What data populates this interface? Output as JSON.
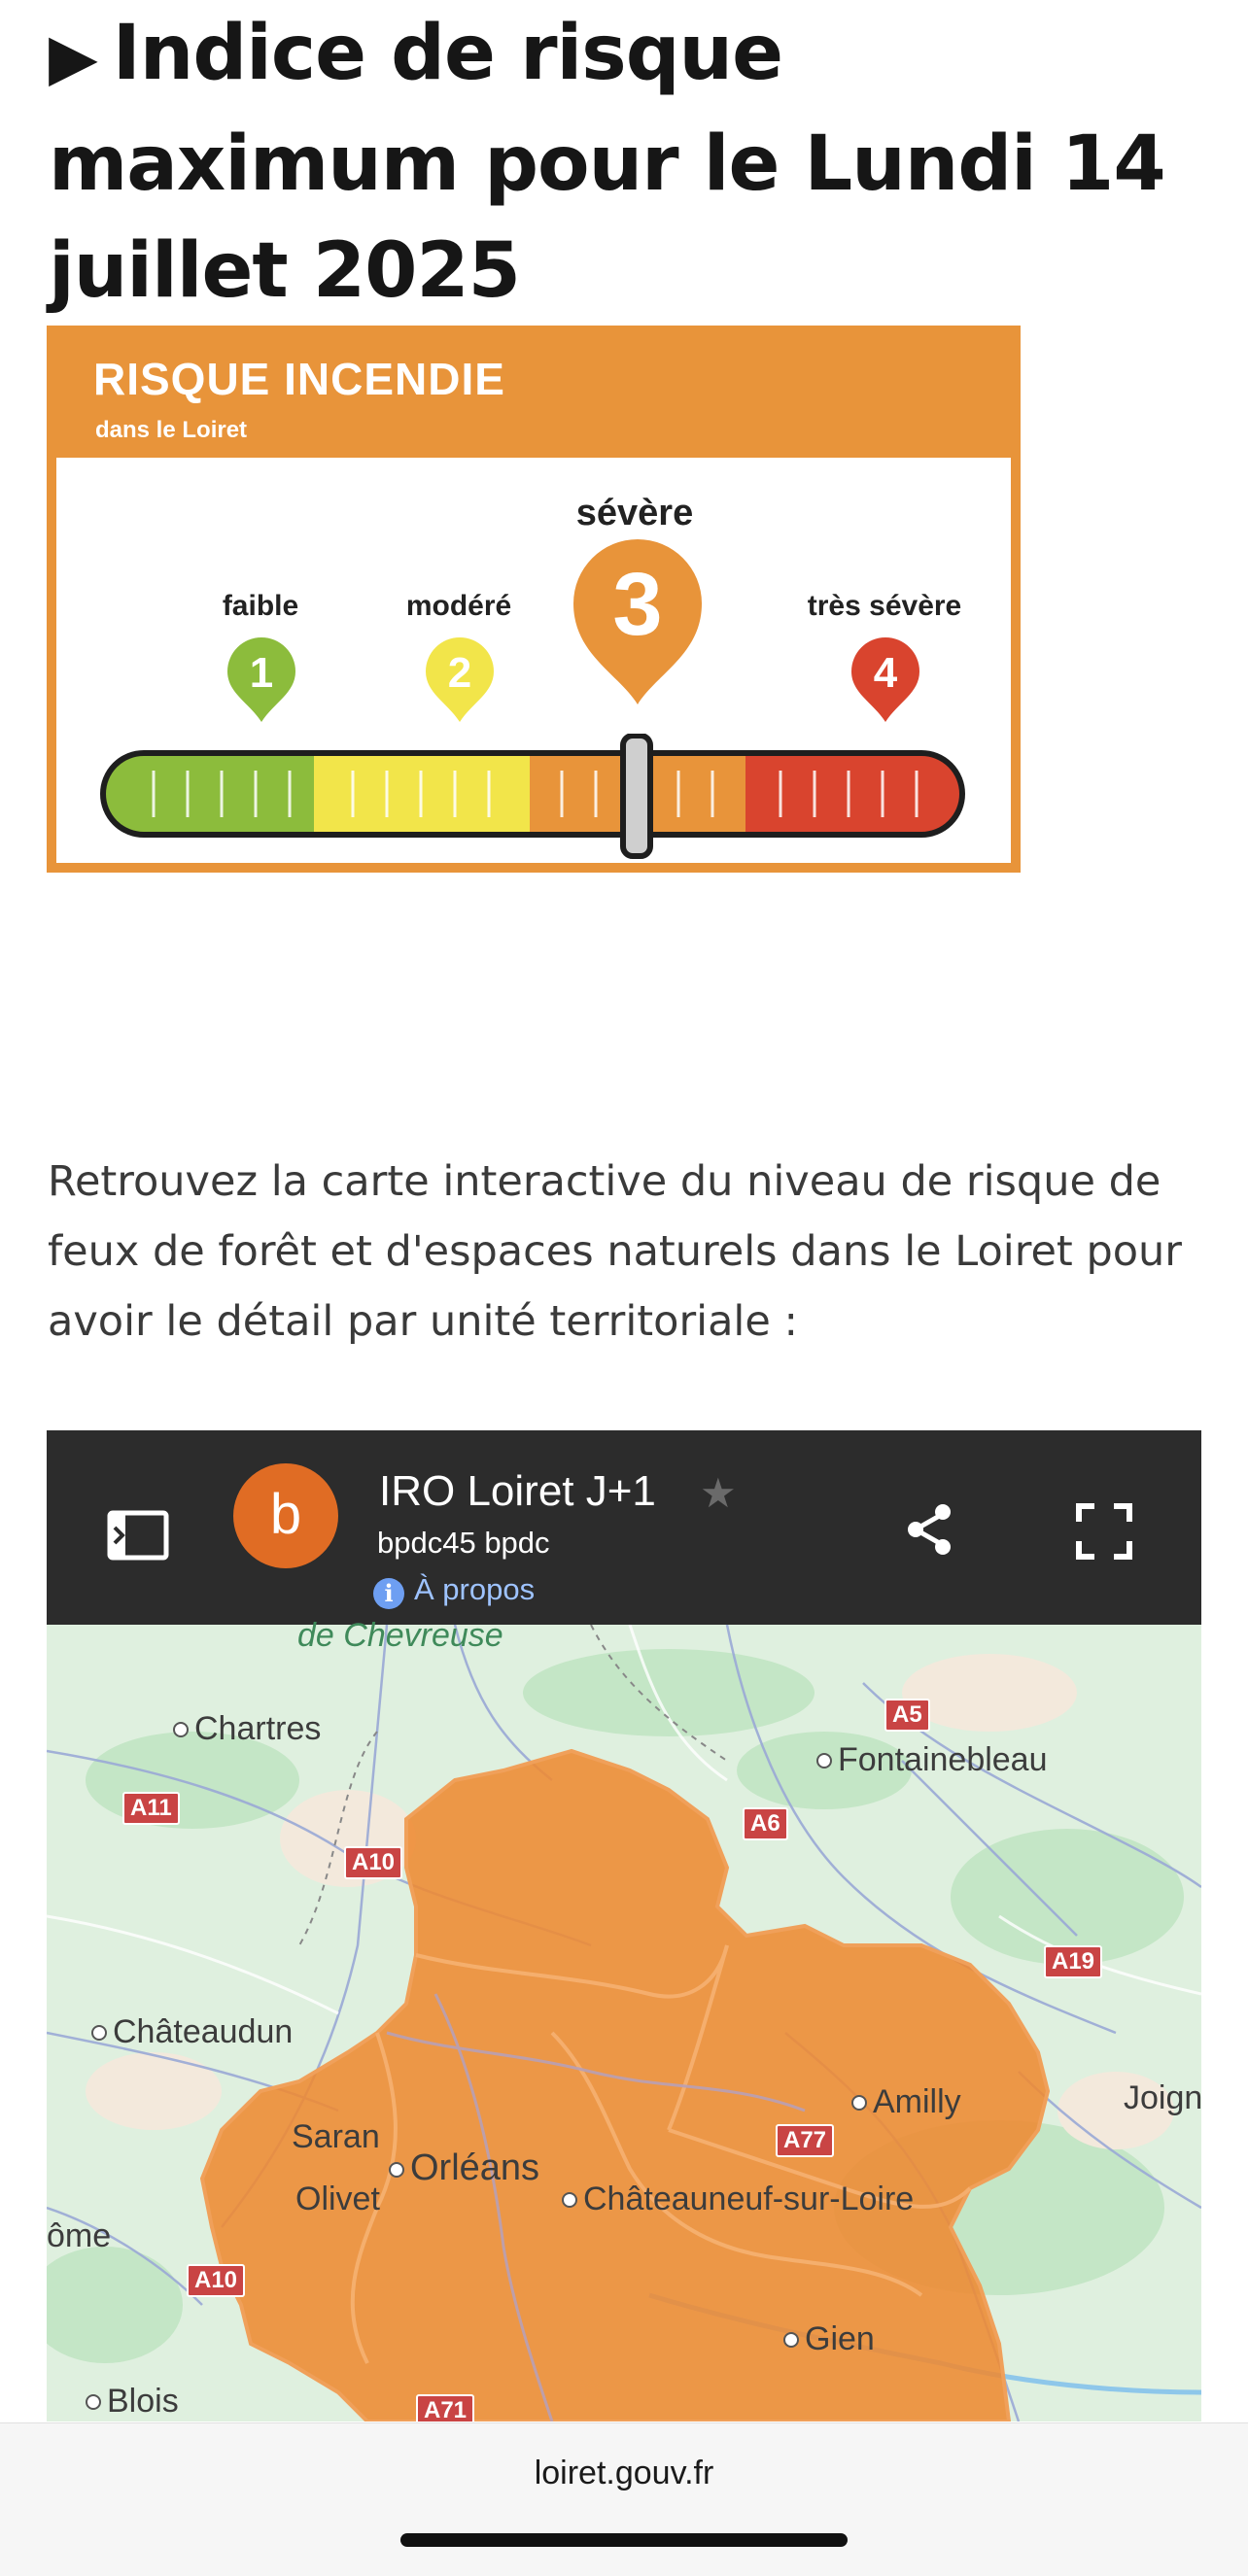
{
  "heading": {
    "icon": "play-triangle-icon",
    "text": "Indice de risque maximum pour le Lundi 14 juillet 2025"
  },
  "risk_card": {
    "title": "RISQUE INCENDIE",
    "subtitle": "dans le Loiret",
    "current_level": 3,
    "levels": [
      {
        "label": "faible",
        "number": "1",
        "color": "#8cbc3c"
      },
      {
        "label": "modéré",
        "number": "2",
        "color": "#f2e54a"
      },
      {
        "label": "sévère",
        "number": "3",
        "color": "#e8943a"
      },
      {
        "label": "très sévère",
        "number": "4",
        "color": "#d9442e"
      }
    ],
    "accent": "#e8943a"
  },
  "paragraph": "Retrouvez la carte interactive du niveau de risque de feux de forêt et d'espaces naturels dans le Loiret pour avoir le détail par unité territoriale :",
  "map_embed": {
    "avatar_letter": "b",
    "title": "IRO Loiret J+1",
    "owner": "bpdc45 bpdc",
    "about_label": "À propos",
    "icons": [
      "sidebar-toggle-icon",
      "star-icon",
      "share-icon",
      "fullscreen-icon"
    ],
    "places": [
      "de Chevreuse",
      "Chartres",
      "Fontainebleau",
      "Châteaudun",
      "Joigny",
      "Amilly",
      "Saran",
      "Orléans",
      "Olivet",
      "Châteauneuf-sur-Loire",
      "ôme",
      "Gien",
      "Blois"
    ],
    "roads": [
      "A5",
      "A11",
      "A6",
      "A10",
      "A19",
      "A77",
      "A10",
      "A71"
    ],
    "zone_color": "#ee8a32"
  },
  "browser": {
    "url": "loiret.gouv.fr"
  }
}
